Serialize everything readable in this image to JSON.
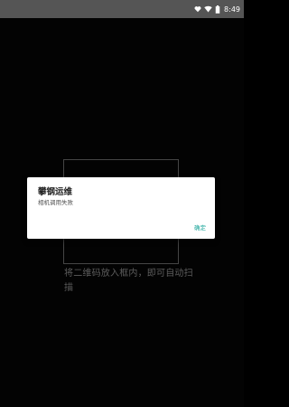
{
  "status_bar": {
    "time": "8:49",
    "icons": [
      "heart-icon",
      "wifi-icon",
      "battery-icon"
    ]
  },
  "scanner": {
    "hint": "将二维码放入框内，即可自动扫描"
  },
  "dialog": {
    "title": "攀钢运维",
    "message": "相机调用失败",
    "ok_label": "确定",
    "accent_color": "#1aa59a"
  }
}
